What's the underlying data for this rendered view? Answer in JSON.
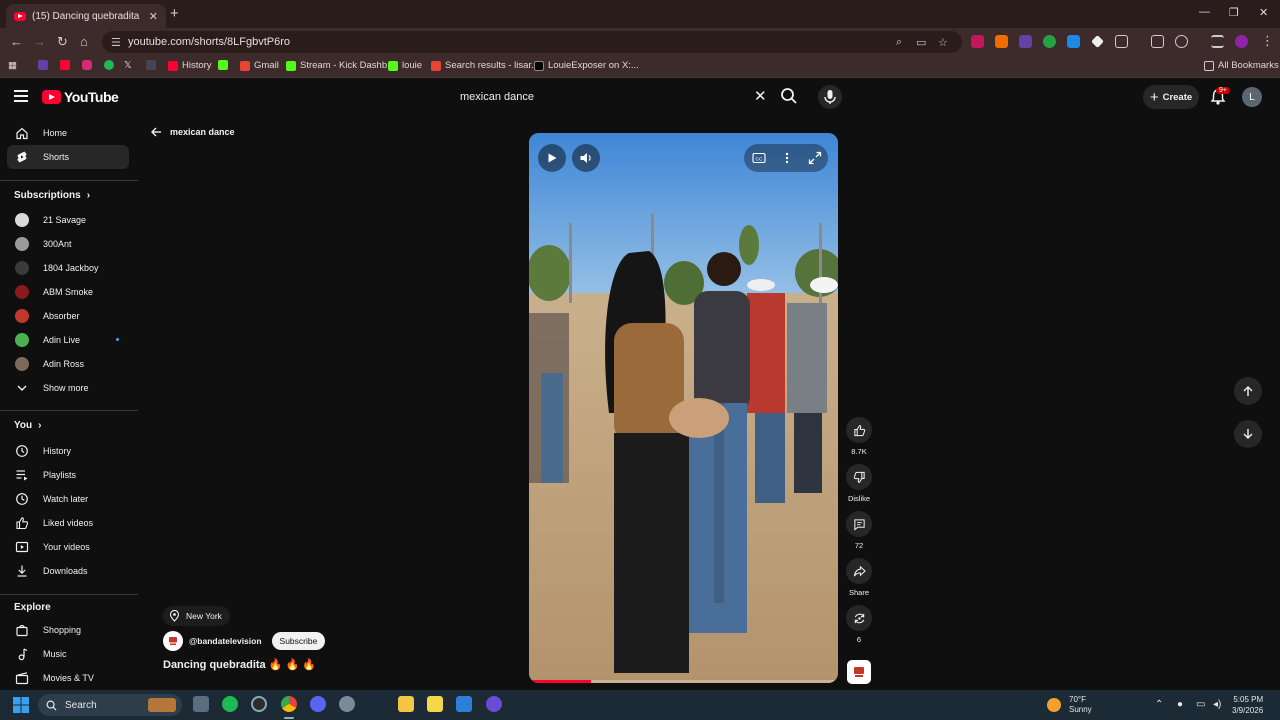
{
  "browser": {
    "tab_title": "(15) Dancing quebradita 🔥 🔊",
    "url": "youtube.com/shorts/8LFgbvtP6ro",
    "bookmarks": [
      "History",
      "Gmail",
      "Stream - Kick Dashb...",
      "louie",
      "Search results - lisar...",
      "LouieExposer on X:..."
    ],
    "all_bookmarks": "All Bookmarks"
  },
  "header": {
    "logo_text": "YouTube",
    "search_value": "mexican dance",
    "create_label": "Create",
    "notif_count": "9+",
    "avatar_letter": "L"
  },
  "sidebar": {
    "main": [
      {
        "label": "Home",
        "icon": "home-icon"
      },
      {
        "label": "Shorts",
        "icon": "shorts-icon"
      }
    ],
    "subscriptions_heading": "Subscriptions",
    "subscriptions": [
      {
        "label": "21 Savage",
        "color": "#d9d9d9"
      },
      {
        "label": "300Ant",
        "color": "#9a9a9a"
      },
      {
        "label": "1804 Jackboy",
        "color": "#3a3a3a"
      },
      {
        "label": "ABM Smoke",
        "color": "#8b1a1a"
      },
      {
        "label": "Absorber",
        "color": "#c0392b"
      },
      {
        "label": "Adin Live",
        "color": "#4caf50"
      },
      {
        "label": "Adin Ross",
        "color": "#7a6a5a"
      }
    ],
    "show_more": "Show more",
    "you_heading": "You",
    "you_items": [
      {
        "label": "History"
      },
      {
        "label": "Playlists"
      },
      {
        "label": "Watch later"
      },
      {
        "label": "Liked videos"
      },
      {
        "label": "Your videos"
      },
      {
        "label": "Downloads"
      }
    ],
    "explore_heading": "Explore",
    "explore_items": [
      {
        "label": "Shopping"
      },
      {
        "label": "Music"
      },
      {
        "label": "Movies & TV"
      }
    ]
  },
  "shorts": {
    "back_label": "mexican dance",
    "progress": 0.2,
    "likes": "8.7K",
    "dislike_label": "Dislike",
    "comments": "72",
    "share_label": "Share",
    "remix_count": "6",
    "location": "New York",
    "channel": "@bandatelevision",
    "subscribe_label": "Subscribe",
    "title": "Dancing quebradita 🔥 🔥 🔥"
  },
  "taskbar": {
    "search_placeholder": "Search",
    "temperature": "70°F",
    "condition": "Sunny",
    "time": "5:05 PM",
    "date": "3/9/2026"
  },
  "colors": {
    "yt_red": "#ff0033",
    "background": "#0f0f0f",
    "chrome_bg": "#3d2a2a"
  }
}
